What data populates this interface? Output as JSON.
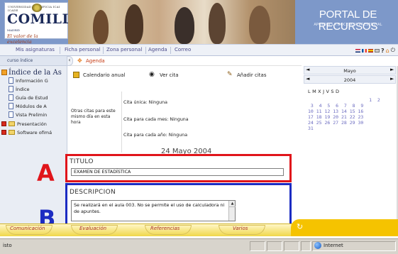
{
  "header": {
    "logo_top_text": "UNIVERSIDAD PONTIFICIA ICAI ICADE",
    "logo_name": "COMILLAS",
    "logo_city": "MADRID",
    "logo_slogan_1": "El valor de la",
    "logo_slogan_2": "excelencia",
    "portal_title": "PORTAL DE RECURSOS",
    "portal_subtitle": "APOYO A LA DOCENCIA PRESENCIAL"
  },
  "nav": {
    "items": [
      "Mis asignaturas",
      "Ficha personal",
      "Zona personal",
      "Agenda",
      "Correo"
    ],
    "help": "?"
  },
  "tree": {
    "top_label": "curso índice",
    "heading": "Índice de la As",
    "items": [
      {
        "label": "Información G",
        "icon": "doc-icon"
      },
      {
        "label": "Índice",
        "icon": "doc-icon"
      },
      {
        "label": "Guía de Estud",
        "icon": "doc-icon"
      },
      {
        "label": "Módulos de A",
        "icon": "doc-icon"
      },
      {
        "label": "Vista Prelimin",
        "icon": "doc-icon"
      },
      {
        "label": "Presentación",
        "icon": "folder-icon"
      },
      {
        "label": "Software ofimá",
        "icon": "folder-icon"
      }
    ]
  },
  "main": {
    "tab_label": "Agenda",
    "tools": {
      "calendar": "Calendario anual",
      "view": "Ver cita",
      "add": "Añadir citas"
    },
    "otras_citas": "Otras citas para este mismo día en esta hora",
    "cita_unica": "Cita única: Ninguna",
    "cita_mes": "Cita para cada mes: Ninguna",
    "cita_anio": "Cita para cada año: Ninguna",
    "date": "24 Mayo 2004",
    "titulo_label": "TITULO",
    "titulo_value": "EXAMEN DE ESTADÍSTICA",
    "descripcion_label": "DESCRIPCION",
    "descripcion_value": "Se realizará en el aula 003. No se permite el uso de calculadora ni de apuntes."
  },
  "annotations": {
    "a": "A",
    "b": "B",
    "a_color": "#e0151b",
    "b_color": "#1c2cc2"
  },
  "calendar": {
    "month": "Mayo",
    "year": "2004",
    "weekdays": "L   M   X   J   V   S   D",
    "rows": [
      "                      1  2",
      " 3  4  5  6  7  8  9",
      "10 11 12 13 14 15 16",
      "17 18 19 20 21 22 23",
      "24 25 26 27 28 29 30",
      "31"
    ]
  },
  "bottom_bar": {
    "items": [
      "Comunicación",
      "Evaluación",
      "Referencias",
      "Varios"
    ]
  },
  "statusbar": {
    "left": "isto",
    "zone": "Internet"
  }
}
